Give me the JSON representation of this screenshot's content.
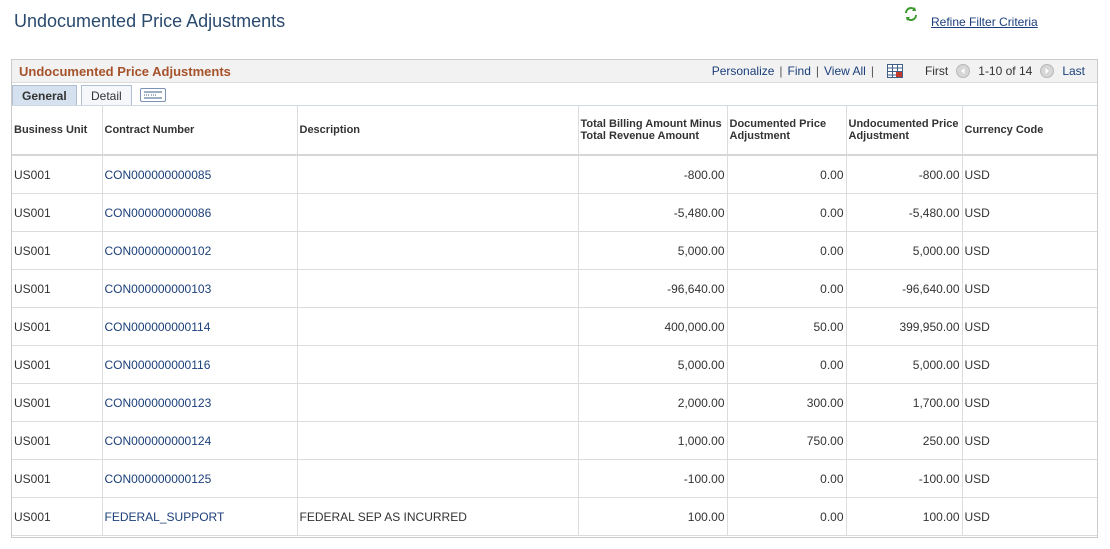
{
  "page": {
    "title": "Undocumented Price Adjustments"
  },
  "refine": {
    "label": "Refine Filter Criteria",
    "icon": "refresh-icon"
  },
  "grid": {
    "title": "Undocumented Price Adjustments",
    "nav": {
      "personalize": "Personalize",
      "find": "Find",
      "view_all": "View All",
      "first": "First",
      "range": "1-10 of 14",
      "last": "Last"
    },
    "tabs": [
      {
        "label": "General",
        "active": true
      },
      {
        "label": "Detail",
        "active": false
      }
    ],
    "columns": [
      "Business Unit",
      "Contract Number",
      "Description",
      "Total Billing Amount Minus Total Revenue Amount",
      "Documented Price Adjustment",
      "Undocumented Price Adjustment",
      "Currency Code"
    ],
    "rows": [
      {
        "business_unit": "US001",
        "contract": "CON000000000085",
        "description": "",
        "total": "-800.00",
        "documented": "0.00",
        "undocumented": "-800.00",
        "currency": "USD"
      },
      {
        "business_unit": "US001",
        "contract": "CON000000000086",
        "description": "",
        "total": "-5,480.00",
        "documented": "0.00",
        "undocumented": "-5,480.00",
        "currency": "USD"
      },
      {
        "business_unit": "US001",
        "contract": "CON000000000102",
        "description": "",
        "total": "5,000.00",
        "documented": "0.00",
        "undocumented": "5,000.00",
        "currency": "USD"
      },
      {
        "business_unit": "US001",
        "contract": "CON000000000103",
        "description": "",
        "total": "-96,640.00",
        "documented": "0.00",
        "undocumented": "-96,640.00",
        "currency": "USD"
      },
      {
        "business_unit": "US001",
        "contract": "CON000000000114",
        "description": "",
        "total": "400,000.00",
        "documented": "50.00",
        "undocumented": "399,950.00",
        "currency": "USD"
      },
      {
        "business_unit": "US001",
        "contract": "CON000000000116",
        "description": "",
        "total": "5,000.00",
        "documented": "0.00",
        "undocumented": "5,000.00",
        "currency": "USD"
      },
      {
        "business_unit": "US001",
        "contract": "CON000000000123",
        "description": "",
        "total": "2,000.00",
        "documented": "300.00",
        "undocumented": "1,700.00",
        "currency": "USD"
      },
      {
        "business_unit": "US001",
        "contract": "CON000000000124",
        "description": "",
        "total": "1,000.00",
        "documented": "750.00",
        "undocumented": "250.00",
        "currency": "USD"
      },
      {
        "business_unit": "US001",
        "contract": "CON000000000125",
        "description": "",
        "total": "-100.00",
        "documented": "0.00",
        "undocumented": "-100.00",
        "currency": "USD"
      },
      {
        "business_unit": "US001",
        "contract": "FEDERAL_SUPPORT",
        "description": "FEDERAL SEP AS INCURRED",
        "total": "100.00",
        "documented": "0.00",
        "undocumented": "100.00",
        "currency": "USD"
      }
    ]
  }
}
